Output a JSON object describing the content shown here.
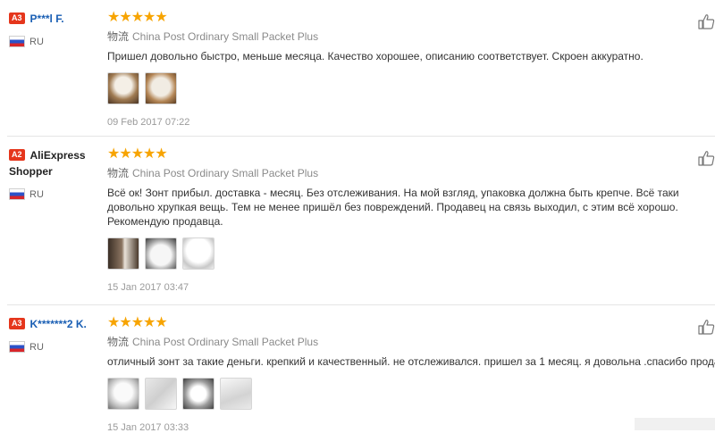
{
  "reviews": [
    {
      "level": "A3",
      "name": "P***l F.",
      "country": "RU",
      "stars": "★★★★★",
      "logistics_cn": "物流",
      "logistics": "China Post Ordinary Small Packet Plus",
      "text": "Пришел довольно быстро, меньше месяца. Качество хорошее, описанию соответствует. Скроен аккуратно.",
      "photo_count": 2,
      "date": "09 Feb 2017 07:22"
    },
    {
      "level": "A2",
      "name": "AliExpress Shopper",
      "country": "RU",
      "stars": "★★★★★",
      "logistics_cn": "物流",
      "logistics": "China Post Ordinary Small Packet Plus",
      "text": "Всё ок! Зонт прибыл. доставка - месяц. Без отслеживания. На мой взгляд, упаковка должна быть крепче. Всё таки довольно хрупкая вещь. Тем не менее пришёл без повреждений. Продавец на связь выходил, с этим всё хорошо. Рекомендую продавца.",
      "photo_count": 3,
      "date": "15 Jan 2017 03:47"
    },
    {
      "level": "A3",
      "name": "K*******2 K.",
      "country": "RU",
      "stars": "★★★★★",
      "logistics_cn": "物流",
      "logistics": "China Post Ordinary Small Packet Plus",
      "text": "отличный зонт за такие деньги. крепкий и качественный. не отслеживался. пришел за 1 месяц. я довольна .спасибо продавцу",
      "photo_count": 4,
      "date": "15 Jan 2017 03:33"
    }
  ],
  "icons": {
    "like": "thumbs-up-icon",
    "flag": "russia-flag-icon"
  },
  "colors": {
    "accent": "#e5361c",
    "star": "#f7a400",
    "name_link": "#1a5fb4"
  }
}
